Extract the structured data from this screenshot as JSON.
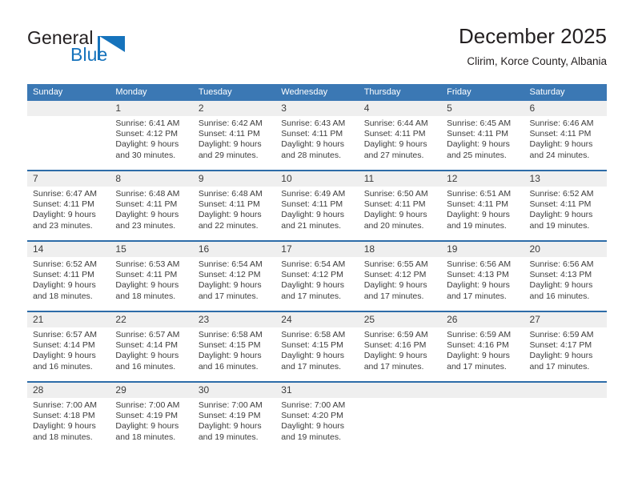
{
  "brand": {
    "name_part1": "General",
    "name_part2": "Blue",
    "flag_icon": "blue-triangle-flag-icon",
    "color_dark": "#231f20",
    "color_blue": "#1673bc"
  },
  "header": {
    "title": "December 2025",
    "subtitle": "Clirim, Korce County, Albania"
  },
  "theme": {
    "header_band": "#3b78b4",
    "week_divider": "#2d6ca8",
    "daynum_strip": "#efefef",
    "text": "#3c3c3c"
  },
  "weekday_headers": [
    "Sunday",
    "Monday",
    "Tuesday",
    "Wednesday",
    "Thursday",
    "Friday",
    "Saturday"
  ],
  "weeks": [
    [
      {
        "day": "",
        "sunrise": "",
        "sunset": "",
        "daylight_line1": "",
        "daylight_line2": ""
      },
      {
        "day": "1",
        "sunrise": "Sunrise: 6:41 AM",
        "sunset": "Sunset: 4:12 PM",
        "daylight_line1": "Daylight: 9 hours",
        "daylight_line2": "and 30 minutes."
      },
      {
        "day": "2",
        "sunrise": "Sunrise: 6:42 AM",
        "sunset": "Sunset: 4:11 PM",
        "daylight_line1": "Daylight: 9 hours",
        "daylight_line2": "and 29 minutes."
      },
      {
        "day": "3",
        "sunrise": "Sunrise: 6:43 AM",
        "sunset": "Sunset: 4:11 PM",
        "daylight_line1": "Daylight: 9 hours",
        "daylight_line2": "and 28 minutes."
      },
      {
        "day": "4",
        "sunrise": "Sunrise: 6:44 AM",
        "sunset": "Sunset: 4:11 PM",
        "daylight_line1": "Daylight: 9 hours",
        "daylight_line2": "and 27 minutes."
      },
      {
        "day": "5",
        "sunrise": "Sunrise: 6:45 AM",
        "sunset": "Sunset: 4:11 PM",
        "daylight_line1": "Daylight: 9 hours",
        "daylight_line2": "and 25 minutes."
      },
      {
        "day": "6",
        "sunrise": "Sunrise: 6:46 AM",
        "sunset": "Sunset: 4:11 PM",
        "daylight_line1": "Daylight: 9 hours",
        "daylight_line2": "and 24 minutes."
      }
    ],
    [
      {
        "day": "7",
        "sunrise": "Sunrise: 6:47 AM",
        "sunset": "Sunset: 4:11 PM",
        "daylight_line1": "Daylight: 9 hours",
        "daylight_line2": "and 23 minutes."
      },
      {
        "day": "8",
        "sunrise": "Sunrise: 6:48 AM",
        "sunset": "Sunset: 4:11 PM",
        "daylight_line1": "Daylight: 9 hours",
        "daylight_line2": "and 23 minutes."
      },
      {
        "day": "9",
        "sunrise": "Sunrise: 6:48 AM",
        "sunset": "Sunset: 4:11 PM",
        "daylight_line1": "Daylight: 9 hours",
        "daylight_line2": "and 22 minutes."
      },
      {
        "day": "10",
        "sunrise": "Sunrise: 6:49 AM",
        "sunset": "Sunset: 4:11 PM",
        "daylight_line1": "Daylight: 9 hours",
        "daylight_line2": "and 21 minutes."
      },
      {
        "day": "11",
        "sunrise": "Sunrise: 6:50 AM",
        "sunset": "Sunset: 4:11 PM",
        "daylight_line1": "Daylight: 9 hours",
        "daylight_line2": "and 20 minutes."
      },
      {
        "day": "12",
        "sunrise": "Sunrise: 6:51 AM",
        "sunset": "Sunset: 4:11 PM",
        "daylight_line1": "Daylight: 9 hours",
        "daylight_line2": "and 19 minutes."
      },
      {
        "day": "13",
        "sunrise": "Sunrise: 6:52 AM",
        "sunset": "Sunset: 4:11 PM",
        "daylight_line1": "Daylight: 9 hours",
        "daylight_line2": "and 19 minutes."
      }
    ],
    [
      {
        "day": "14",
        "sunrise": "Sunrise: 6:52 AM",
        "sunset": "Sunset: 4:11 PM",
        "daylight_line1": "Daylight: 9 hours",
        "daylight_line2": "and 18 minutes."
      },
      {
        "day": "15",
        "sunrise": "Sunrise: 6:53 AM",
        "sunset": "Sunset: 4:11 PM",
        "daylight_line1": "Daylight: 9 hours",
        "daylight_line2": "and 18 minutes."
      },
      {
        "day": "16",
        "sunrise": "Sunrise: 6:54 AM",
        "sunset": "Sunset: 4:12 PM",
        "daylight_line1": "Daylight: 9 hours",
        "daylight_line2": "and 17 minutes."
      },
      {
        "day": "17",
        "sunrise": "Sunrise: 6:54 AM",
        "sunset": "Sunset: 4:12 PM",
        "daylight_line1": "Daylight: 9 hours",
        "daylight_line2": "and 17 minutes."
      },
      {
        "day": "18",
        "sunrise": "Sunrise: 6:55 AM",
        "sunset": "Sunset: 4:12 PM",
        "daylight_line1": "Daylight: 9 hours",
        "daylight_line2": "and 17 minutes."
      },
      {
        "day": "19",
        "sunrise": "Sunrise: 6:56 AM",
        "sunset": "Sunset: 4:13 PM",
        "daylight_line1": "Daylight: 9 hours",
        "daylight_line2": "and 17 minutes."
      },
      {
        "day": "20",
        "sunrise": "Sunrise: 6:56 AM",
        "sunset": "Sunset: 4:13 PM",
        "daylight_line1": "Daylight: 9 hours",
        "daylight_line2": "and 16 minutes."
      }
    ],
    [
      {
        "day": "21",
        "sunrise": "Sunrise: 6:57 AM",
        "sunset": "Sunset: 4:14 PM",
        "daylight_line1": "Daylight: 9 hours",
        "daylight_line2": "and 16 minutes."
      },
      {
        "day": "22",
        "sunrise": "Sunrise: 6:57 AM",
        "sunset": "Sunset: 4:14 PM",
        "daylight_line1": "Daylight: 9 hours",
        "daylight_line2": "and 16 minutes."
      },
      {
        "day": "23",
        "sunrise": "Sunrise: 6:58 AM",
        "sunset": "Sunset: 4:15 PM",
        "daylight_line1": "Daylight: 9 hours",
        "daylight_line2": "and 16 minutes."
      },
      {
        "day": "24",
        "sunrise": "Sunrise: 6:58 AM",
        "sunset": "Sunset: 4:15 PM",
        "daylight_line1": "Daylight: 9 hours",
        "daylight_line2": "and 17 minutes."
      },
      {
        "day": "25",
        "sunrise": "Sunrise: 6:59 AM",
        "sunset": "Sunset: 4:16 PM",
        "daylight_line1": "Daylight: 9 hours",
        "daylight_line2": "and 17 minutes."
      },
      {
        "day": "26",
        "sunrise": "Sunrise: 6:59 AM",
        "sunset": "Sunset: 4:16 PM",
        "daylight_line1": "Daylight: 9 hours",
        "daylight_line2": "and 17 minutes."
      },
      {
        "day": "27",
        "sunrise": "Sunrise: 6:59 AM",
        "sunset": "Sunset: 4:17 PM",
        "daylight_line1": "Daylight: 9 hours",
        "daylight_line2": "and 17 minutes."
      }
    ],
    [
      {
        "day": "28",
        "sunrise": "Sunrise: 7:00 AM",
        "sunset": "Sunset: 4:18 PM",
        "daylight_line1": "Daylight: 9 hours",
        "daylight_line2": "and 18 minutes."
      },
      {
        "day": "29",
        "sunrise": "Sunrise: 7:00 AM",
        "sunset": "Sunset: 4:19 PM",
        "daylight_line1": "Daylight: 9 hours",
        "daylight_line2": "and 18 minutes."
      },
      {
        "day": "30",
        "sunrise": "Sunrise: 7:00 AM",
        "sunset": "Sunset: 4:19 PM",
        "daylight_line1": "Daylight: 9 hours",
        "daylight_line2": "and 19 minutes."
      },
      {
        "day": "31",
        "sunrise": "Sunrise: 7:00 AM",
        "sunset": "Sunset: 4:20 PM",
        "daylight_line1": "Daylight: 9 hours",
        "daylight_line2": "and 19 minutes."
      },
      {
        "day": "",
        "sunrise": "",
        "sunset": "",
        "daylight_line1": "",
        "daylight_line2": ""
      },
      {
        "day": "",
        "sunrise": "",
        "sunset": "",
        "daylight_line1": "",
        "daylight_line2": ""
      },
      {
        "day": "",
        "sunrise": "",
        "sunset": "",
        "daylight_line1": "",
        "daylight_line2": ""
      }
    ]
  ]
}
